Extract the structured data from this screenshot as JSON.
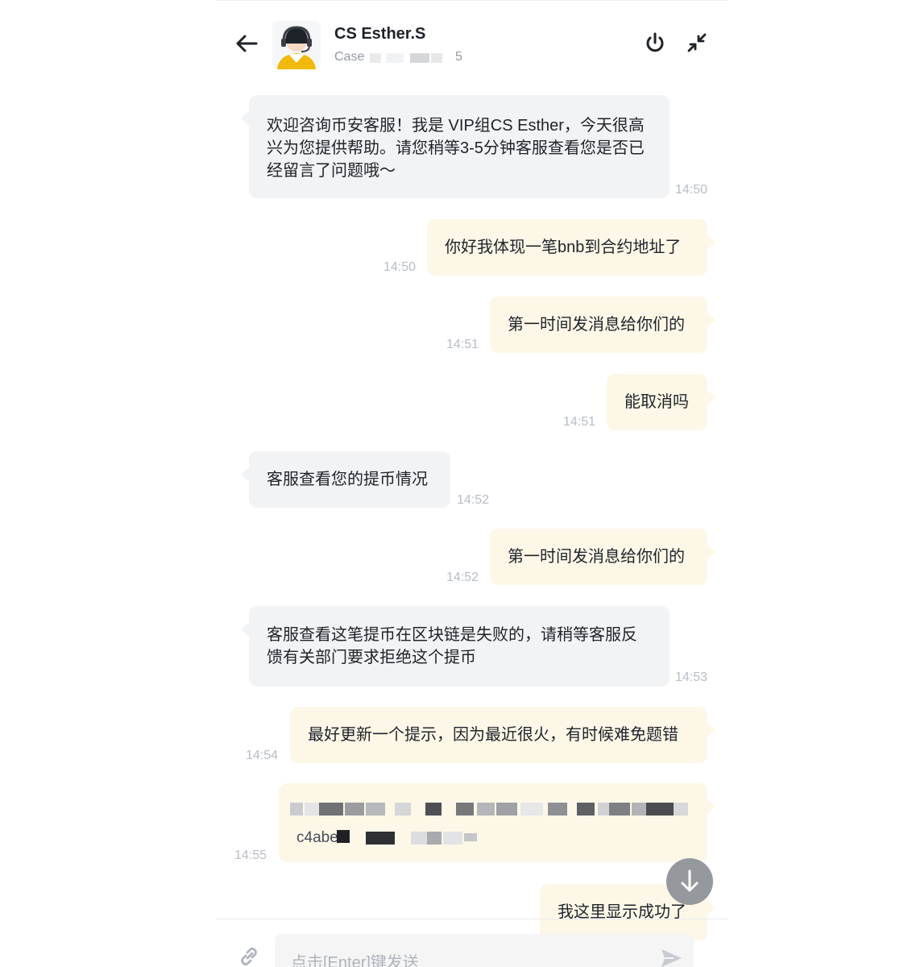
{
  "header": {
    "back_icon": "arrow-left-icon",
    "agent_name": "CS Esther.S",
    "case_label": "Case",
    "case_suffix": "5",
    "power_icon": "power-icon",
    "minimize_icon": "minimize-arrows-icon"
  },
  "messages": [
    {
      "side": "in",
      "text": "欢迎咨询币安客服！我是 VIP组CS Esther，今天很高兴为您提供帮助。请您稍等3-5分钟客服查看您是否已经留言了问题哦～",
      "time": "14:50"
    },
    {
      "side": "out",
      "text": "你好我体现一笔bnb到合约地址了",
      "time": "14:50"
    },
    {
      "side": "out",
      "text": "第一时间发消息给你们的",
      "time": "14:51"
    },
    {
      "side": "out",
      "text": "能取消吗",
      "time": "14:51"
    },
    {
      "side": "in",
      "text": "客服查看您的提币情况",
      "time": "14:52"
    },
    {
      "side": "out",
      "text": "第一时间发消息给你们的",
      "time": "14:52"
    },
    {
      "side": "in",
      "text": "客服查看这笔提币在区块链是失败的，请稍等客服反馈有关部门要求拒绝这个提币",
      "time": "14:53"
    },
    {
      "side": "out",
      "text": "最好更新一个提示，因为最近很火，有时候难免题错",
      "time": "14:54"
    },
    {
      "side": "out",
      "text": "c4abe",
      "time": "14:55",
      "masked": true
    },
    {
      "side": "out",
      "text": "我这里显示成功了",
      "time": ""
    }
  ],
  "scroll_icon": "arrow-down-icon",
  "composer": {
    "link_icon": "link-icon",
    "placeholder": "点击[Enter]键发送",
    "value": "",
    "send_icon": "send-icon"
  },
  "colors": {
    "incoming_bubble": "#f2f3f5",
    "outgoing_bubble": "#fdf7e7",
    "timestamp": "#b7bdc6",
    "avatar_accent": "#f0b90b"
  }
}
